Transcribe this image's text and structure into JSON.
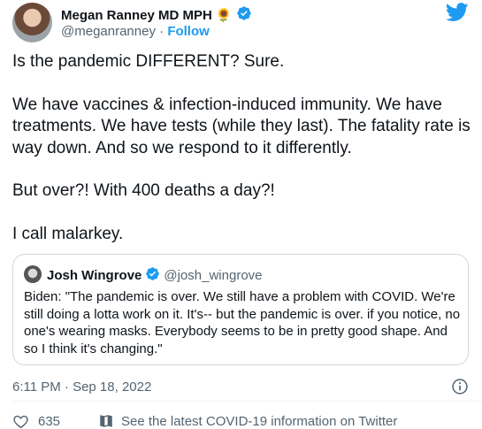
{
  "author": {
    "name": "Megan Ranney MD MPH",
    "emoji": "🌻",
    "handle": "@meganranney",
    "separator": "·",
    "follow_label": "Follow"
  },
  "tweet": {
    "paragraphs": [
      "Is the pandemic DIFFERENT? Sure.",
      "We have vaccines & infection-induced immunity. We have treatments. We have tests (while they last). The fatality rate is way down. And so we respond to it differently.",
      "But over?! With 400 deaths a day?!",
      "I call malarkey."
    ]
  },
  "quoted": {
    "name": "Josh Wingrove",
    "handle": "@josh_wingrove",
    "text": "Biden: \"The pandemic is over. We still have a problem with COVID. We're still doing a lotta work on it. It's-- but the pandemic is over. if you notice, no one's wearing masks. Everybody seems to be in pretty good shape. And so I think it's changing.\""
  },
  "timestamp": "6:11 PM · Sep 18, 2022",
  "actions": {
    "like_count": "635",
    "covid_info": "See the latest COVID-19 information on Twitter"
  },
  "colors": {
    "twitter_blue": "#1d9bf0",
    "muted_text": "#536471",
    "border": "#cfd9de"
  },
  "icons": [
    "verified-badge-icon",
    "twitter-bird-icon",
    "info-icon",
    "heart-icon",
    "covid-info-icon"
  ]
}
